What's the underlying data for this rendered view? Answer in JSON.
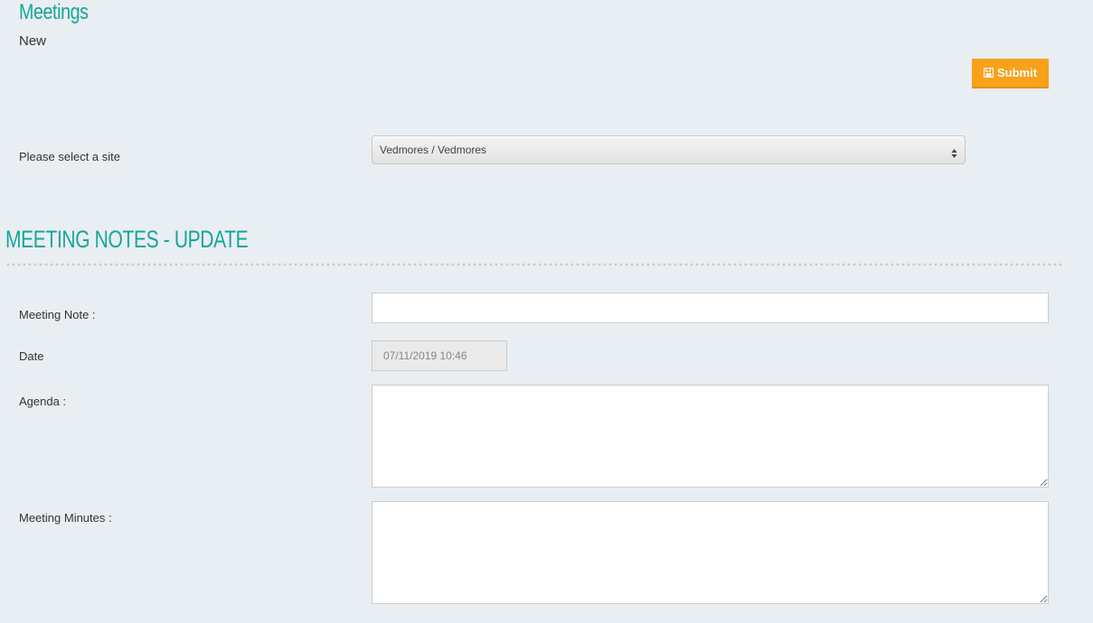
{
  "header": {
    "title": "Meetings",
    "subtitle": "New"
  },
  "toolbar": {
    "submit_label": "Submit",
    "submit_icon": "floppy-disk-icon"
  },
  "site": {
    "label": "Please select a site",
    "selected": "Vedmores / Vedmores"
  },
  "section": {
    "title": "MEETING NOTES - UPDATE"
  },
  "form": {
    "meeting_note_label": "Meeting Note :",
    "meeting_note_value": "",
    "date_label": "Date",
    "date_value": "07/11/2019 10:46",
    "agenda_label": "Agenda :",
    "agenda_value": "",
    "minutes_label": "Meeting Minutes :",
    "minutes_value": ""
  },
  "colors": {
    "accent": "#17a69a",
    "button": "#f8a11a",
    "background": "#e9eef2"
  }
}
